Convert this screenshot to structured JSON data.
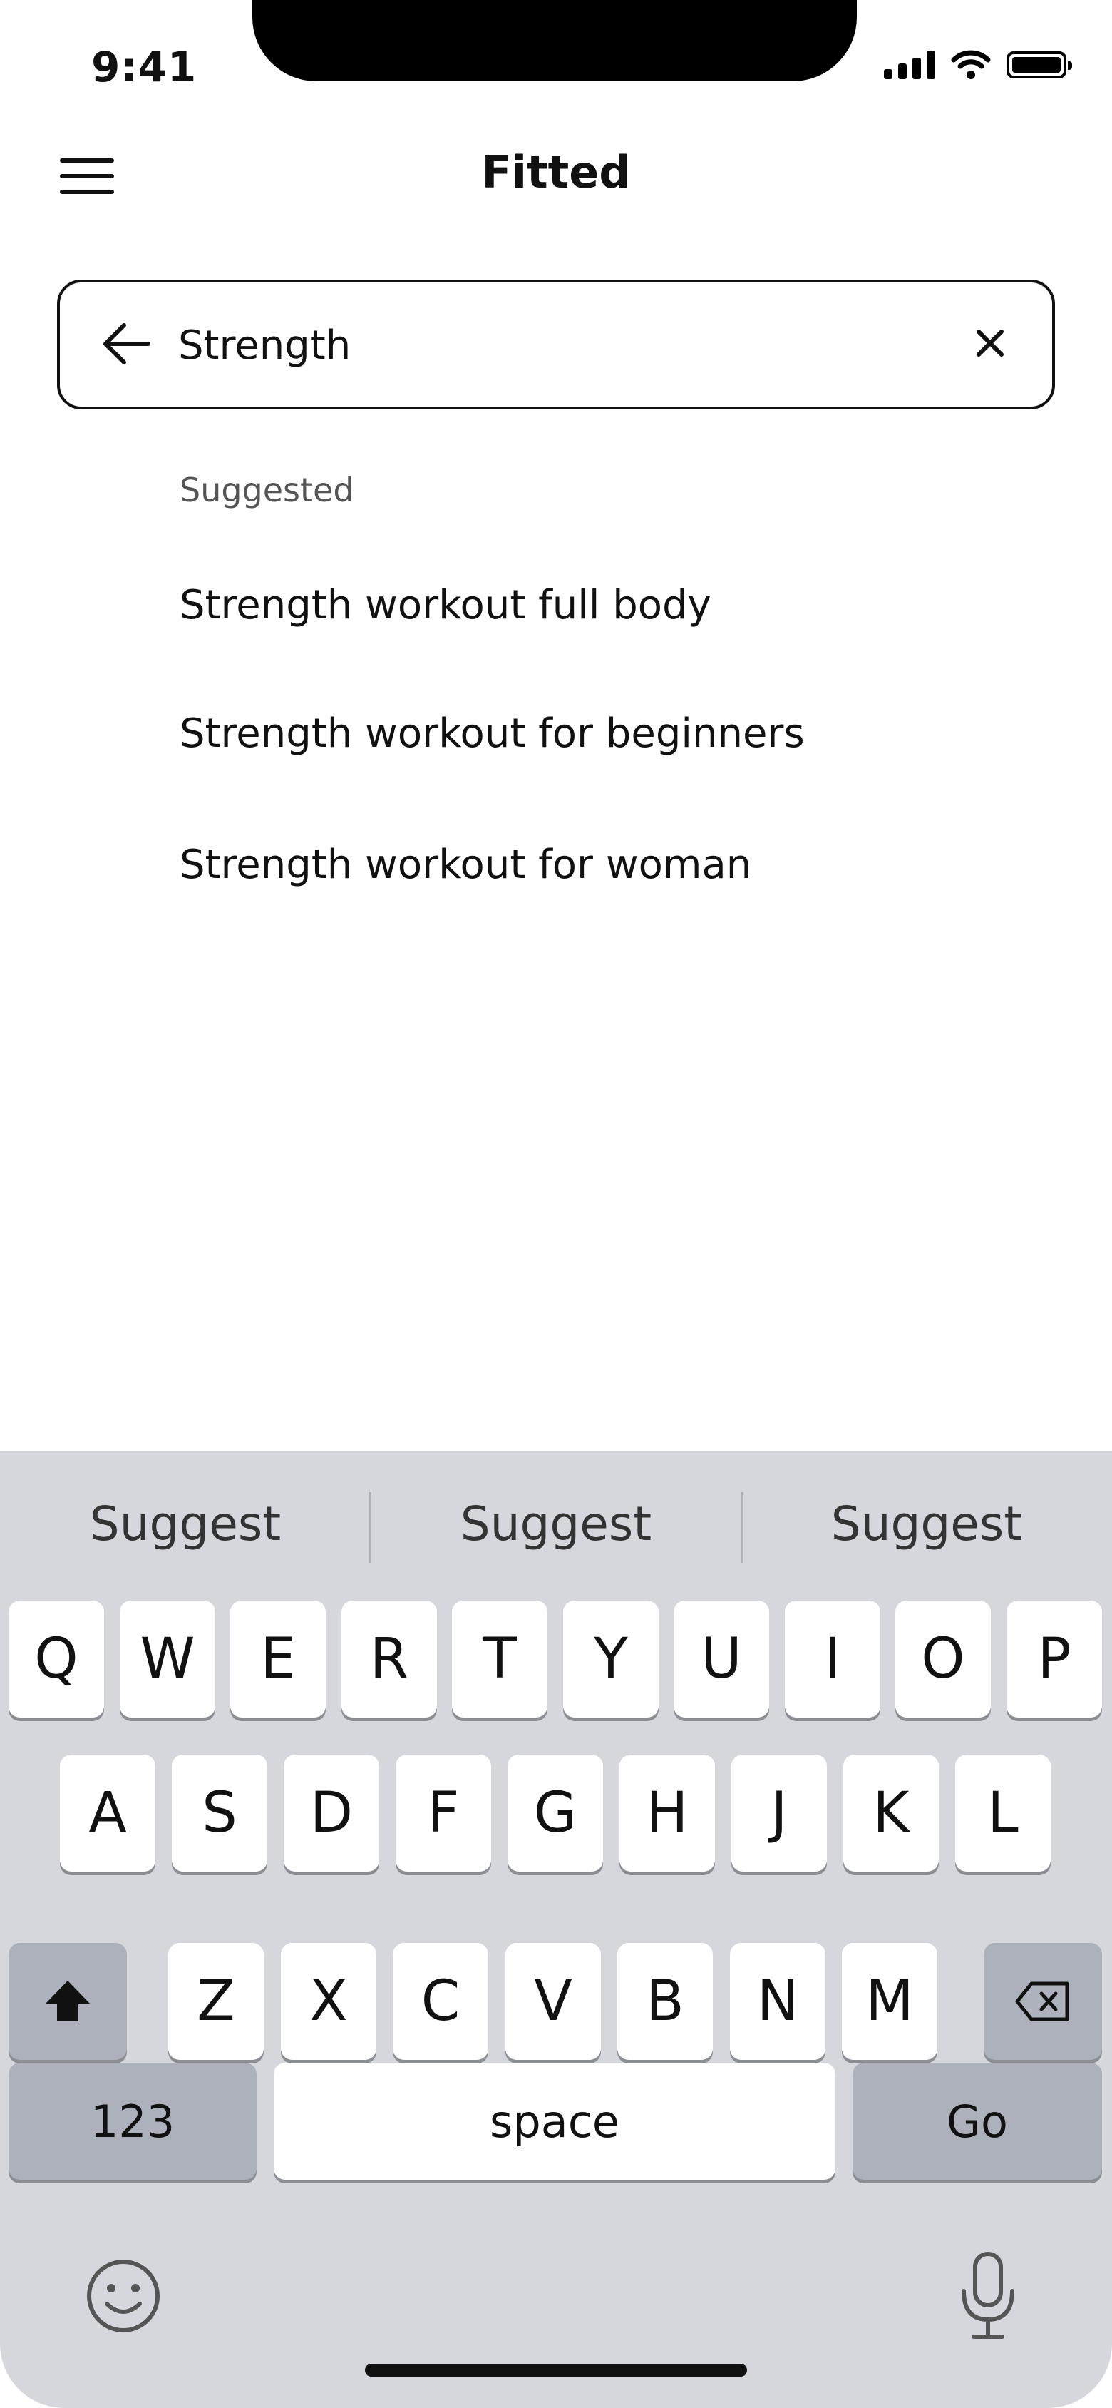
{
  "status_bar": {
    "time": "9:41"
  },
  "header": {
    "title": "Fitted"
  },
  "search": {
    "value": "Strength"
  },
  "suggestions": {
    "header": "Suggested",
    "items": [
      "Strength workout full body",
      "Strength workout for beginners",
      "Strength workout for woman"
    ]
  },
  "keyboard": {
    "predictions": [
      "Suggest",
      "Suggest",
      "Suggest"
    ],
    "row1": [
      "Q",
      "W",
      "E",
      "R",
      "T",
      "Y",
      "U",
      "I",
      "O",
      "P"
    ],
    "row2": [
      "A",
      "S",
      "D",
      "F",
      "G",
      "H",
      "J",
      "K",
      "L"
    ],
    "row3": [
      "Z",
      "X",
      "C",
      "V",
      "B",
      "N",
      "M"
    ],
    "numbers_label": "123",
    "space_label": "space",
    "go_label": "Go"
  }
}
